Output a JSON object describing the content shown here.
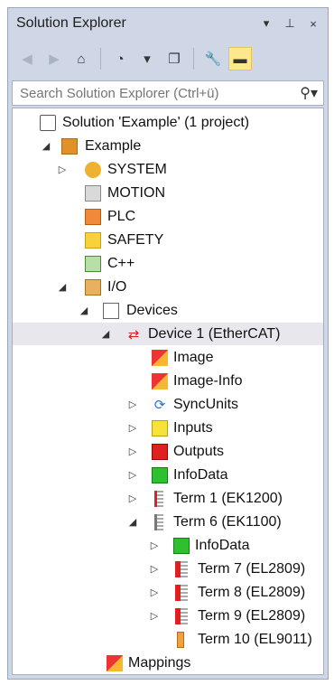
{
  "panel": {
    "title": "Solution Explorer",
    "title_buttons": [
      "▾",
      "⊥",
      "×"
    ]
  },
  "search": {
    "placeholder": "Search Solution Explorer (Ctrl+ü)"
  },
  "tree": {
    "items": [
      {
        "label": "Solution 'Example' (1 project)",
        "icon": "solution-icon"
      },
      {
        "label": "Example",
        "icon": "project-icon"
      },
      {
        "label": "SYSTEM",
        "icon": "system-icon"
      },
      {
        "label": "MOTION",
        "icon": "motion-icon"
      },
      {
        "label": "PLC",
        "icon": "plc-icon"
      },
      {
        "label": "SAFETY",
        "icon": "safety-icon"
      },
      {
        "label": "C++",
        "icon": "cpp-icon"
      },
      {
        "label": "I/O",
        "icon": "io-icon"
      },
      {
        "label": "Devices",
        "icon": "devices-icon"
      },
      {
        "label": "Device 1 (EtherCAT)",
        "icon": "ethercat-icon"
      },
      {
        "label": "Image",
        "icon": "image-icon"
      },
      {
        "label": "Image-Info",
        "icon": "image-info-icon"
      },
      {
        "label": "SyncUnits",
        "icon": "syncunits-icon"
      },
      {
        "label": "Inputs",
        "icon": "inputs-icon"
      },
      {
        "label": "Outputs",
        "icon": "outputs-icon"
      },
      {
        "label": "InfoData",
        "icon": "infodata-icon"
      },
      {
        "label": "Term 1 (EK1200)",
        "icon": "terminal-icon"
      },
      {
        "label": "Term 6 (EK1100)",
        "icon": "terminal-icon"
      },
      {
        "label": "InfoData",
        "icon": "infodata-icon"
      },
      {
        "label": "Term 7 (EL2809)",
        "icon": "terminal-red-icon"
      },
      {
        "label": "Term 8 (EL2809)",
        "icon": "terminal-red-icon"
      },
      {
        "label": "Term 9 (EL2809)",
        "icon": "terminal-red-icon"
      },
      {
        "label": "Term 10 (EL9011)",
        "icon": "end-terminal-icon"
      },
      {
        "label": "Mappings",
        "icon": "mappings-icon"
      }
    ]
  }
}
